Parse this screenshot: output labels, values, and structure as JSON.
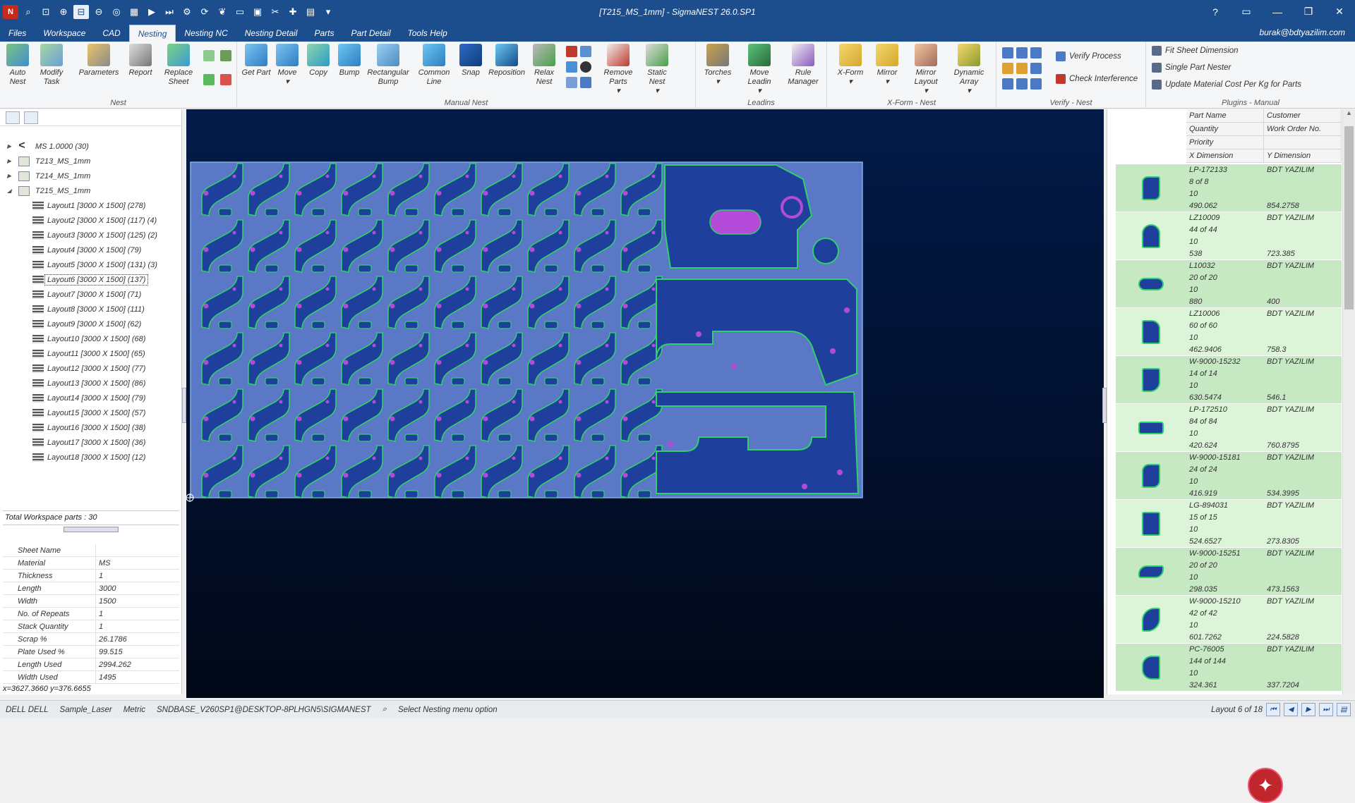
{
  "window": {
    "title": "[T215_MS_1mm] - SigmaNEST 26.0.SP1",
    "user_email": "burak@bdtyazilim.com",
    "controls": [
      "?",
      "▭",
      "—",
      "❐",
      "✕"
    ]
  },
  "menu": [
    "Files",
    "Workspace",
    "CAD",
    "Nesting",
    "Nesting NC",
    "Nesting Detail",
    "Parts",
    "Part Detail",
    "Tools Help"
  ],
  "ribbon": {
    "nest_group": {
      "label": "Nest",
      "buttons": [
        "Auto Nest",
        "Modify Task",
        "Parameters",
        "Report",
        "Replace Sheet"
      ]
    },
    "manual_group": {
      "label": "Manual Nest",
      "buttons": [
        "Get Part",
        "Move",
        "Copy",
        "Bump",
        "Rectangular Bump",
        "Common Line",
        "Snap",
        "Reposition",
        "Relax Nest",
        "Remove Parts",
        "Static Nest"
      ]
    },
    "leadins_group": {
      "label": "Leadins",
      "buttons": [
        "Torches",
        "Move Leadin",
        "Rule Manager"
      ]
    },
    "xform_group": {
      "label": "X-Form - Nest",
      "buttons": [
        "X-Form",
        "Mirror",
        "Mirror Layout",
        "Dynamic Array"
      ]
    },
    "verify_group": {
      "label": "Verify - Nest",
      "items": [
        "Verify Process",
        "Check Interference"
      ]
    },
    "plugins_group": {
      "label": "Plugins - Manual",
      "items": [
        "Fit Sheet Dimension",
        "Single Part Nester",
        "Update Material Cost Per Kg for Parts"
      ]
    }
  },
  "tree": {
    "roots": [
      {
        "label": "MS 1.0000 (30)",
        "expanded": false
      },
      {
        "label": "T213_MS_1mm",
        "expanded": false
      },
      {
        "label": "T214_MS_1mm",
        "expanded": false
      },
      {
        "label": "T215_MS_1mm",
        "expanded": true
      }
    ],
    "layouts": [
      "Layout1 [3000 X 1500]  (278)",
      "Layout2 [3000 X 1500]  (117) (4)",
      "Layout3 [3000 X 1500]  (125) (2)",
      "Layout4 [3000 X 1500]  (79)",
      "Layout5 [3000 X 1500]  (131) (3)",
      "Layout6 [3000 X 1500]  (137)",
      "Layout7 [3000 X 1500]  (71)",
      "Layout8 [3000 X 1500]  (111)",
      "Layout9 [3000 X 1500]  (62)",
      "Layout10 [3000 X 1500]  (68)",
      "Layout11 [3000 X 1500]  (65)",
      "Layout12 [3000 X 1500]  (77)",
      "Layout13 [3000 X 1500]  (86)",
      "Layout14 [3000 X 1500]  (79)",
      "Layout15 [3000 X 1500]  (57)",
      "Layout16 [3000 X 1500]  (38)",
      "Layout17 [3000 X 1500]  (36)",
      "Layout18 [3000 X 1500]  (12)"
    ],
    "selected_layout": 5
  },
  "workspace_parts": "Total Workspace parts : 30",
  "properties": [
    [
      "Sheet Name",
      ""
    ],
    [
      "Material",
      "MS"
    ],
    [
      "Thickness",
      "1"
    ],
    [
      "Length",
      "3000"
    ],
    [
      "Width",
      "1500"
    ],
    [
      "No. of Repeats",
      "1"
    ],
    [
      "Stack Quantity",
      "1"
    ],
    [
      "Scrap %",
      "26.1786"
    ],
    [
      "Plate Used %",
      "99.515"
    ],
    [
      "Length Used",
      "2994.262"
    ],
    [
      "Width Used",
      "1495"
    ]
  ],
  "cursor_coords": "x=3627.3660 y=376.6655",
  "part_list_headers": [
    [
      "Part Name",
      "Customer"
    ],
    [
      "Quantity",
      "Work Order No."
    ],
    [
      "Priority",
      ""
    ],
    [
      "X Dimension",
      "Y Dimension"
    ]
  ],
  "parts": [
    {
      "name": "LP-172133",
      "customer": "BDT YAZILIM",
      "qty": "8 of 8",
      "priority": "10",
      "x": "490.062",
      "y": "854.2758"
    },
    {
      "name": "LZ10009",
      "customer": "BDT YAZILIM",
      "qty": "44 of 44",
      "priority": "10",
      "x": "538",
      "y": "723.385"
    },
    {
      "name": "L10032",
      "customer": "BDT YAZILIM",
      "qty": "20 of 20",
      "priority": "10",
      "x": "880",
      "y": "400"
    },
    {
      "name": "LZ10006",
      "customer": "BDT YAZILIM",
      "qty": "60 of 60",
      "priority": "10",
      "x": "462.9406",
      "y": "758.3"
    },
    {
      "name": "W-9000-15232",
      "customer": "BDT YAZILIM",
      "qty": "14 of 14",
      "priority": "10",
      "x": "630.5474",
      "y": "546.1"
    },
    {
      "name": "LP-172510",
      "customer": "BDT YAZILIM",
      "qty": "84 of 84",
      "priority": "10",
      "x": "420.624",
      "y": "760.8795"
    },
    {
      "name": "W-9000-15181",
      "customer": "BDT YAZILIM",
      "qty": "24 of 24",
      "priority": "10",
      "x": "416.919",
      "y": "534.3995"
    },
    {
      "name": "LG-894031",
      "customer": "BDT YAZILIM",
      "qty": "15 of 15",
      "priority": "10",
      "x": "524.6527",
      "y": "273.8305"
    },
    {
      "name": "W-9000-15251",
      "customer": "BDT YAZILIM",
      "qty": "20 of 20",
      "priority": "10",
      "x": "298.035",
      "y": "473.1563"
    },
    {
      "name": "W-9000-15210",
      "customer": "BDT YAZILIM",
      "qty": "42 of 42",
      "priority": "10",
      "x": "601.7262",
      "y": "224.5828"
    },
    {
      "name": "PC-76005",
      "customer": "BDT YAZILIM",
      "qty": "144 of 144",
      "priority": "10",
      "x": "324.361",
      "y": "337.7204"
    }
  ],
  "status": {
    "user": "DELL DELL",
    "machine": "Sample_Laser",
    "units": "Metric",
    "database": "SNDBASE_V260SP1@DESKTOP-8PLHGN5\\SIGMANEST",
    "message": "Select Nesting menu option",
    "layout_pos": "Layout 6 of 18"
  },
  "colors": {
    "title_bar": "#1c4e8e",
    "sheet_fill": "#5a78c6",
    "part_fill": "#1e3f9c",
    "part_outline": "#2fd06b",
    "hole": "#b44ad8",
    "part_row": "#c6e9c3",
    "ai_button": "#c0272d"
  }
}
